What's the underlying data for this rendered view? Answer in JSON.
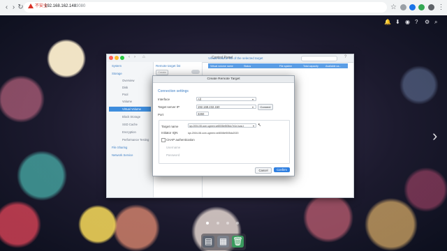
{
  "browser": {
    "security_label": "不安全",
    "url_host": "192.168.162.140",
    "url_port": ":13080"
  },
  "colors": {
    "accent": "#3e8ddd",
    "header_blue": "#5b9ee6",
    "confirm_blue": "#2f7fe0",
    "warning_red": "#d93025"
  },
  "desktop": {
    "page_dots": 4,
    "active_dot": 0
  },
  "control_panel": {
    "title": "Control Panel",
    "sidebar": {
      "items": [
        {
          "label": "System"
        },
        {
          "label": "Storage"
        },
        {
          "label": "Overview"
        },
        {
          "label": "Disk"
        },
        {
          "label": "Pool"
        },
        {
          "label": "Volume"
        },
        {
          "label": "Virtual Volume"
        },
        {
          "label": "Block Storage"
        },
        {
          "label": "SSD Cache"
        },
        {
          "label": "Encryption"
        },
        {
          "label": "Performance Testing"
        },
        {
          "label": "File Sharing"
        },
        {
          "label": "Network Service"
        }
      ]
    },
    "middle": {
      "title": "Remote target list",
      "create_label": "Create"
    },
    "right": {
      "title": "Virtual volume list of the selected target",
      "columns": [
        "Virtual volume name",
        "Status",
        "File system",
        "Total capacity",
        "Available ca..."
      ]
    }
  },
  "dialog": {
    "title": "Create Remote Target",
    "section_title": "Connection settings",
    "interface_label": "Interface",
    "interface_value": "All",
    "target_ip_label": "Target server IP",
    "target_ip_value": "192.168.232.150",
    "connect_label": "Connect",
    "port_label": "Port",
    "port_value": "3260",
    "target_name_label": "Target name",
    "target_name_value": "iqn.2004-08.com.ugreen:ve8008ef005dc7e1e.iscsi-t",
    "initiator_label": "Initiator IQN",
    "initiator_value": "iqn.2004-08.com.ugreen:ve8008ef005dc2020",
    "chap_label": "CHAP authentication",
    "username_label": "Username",
    "password_label": "Password",
    "cancel_label": "Cancel",
    "confirm_label": "Confirm"
  }
}
